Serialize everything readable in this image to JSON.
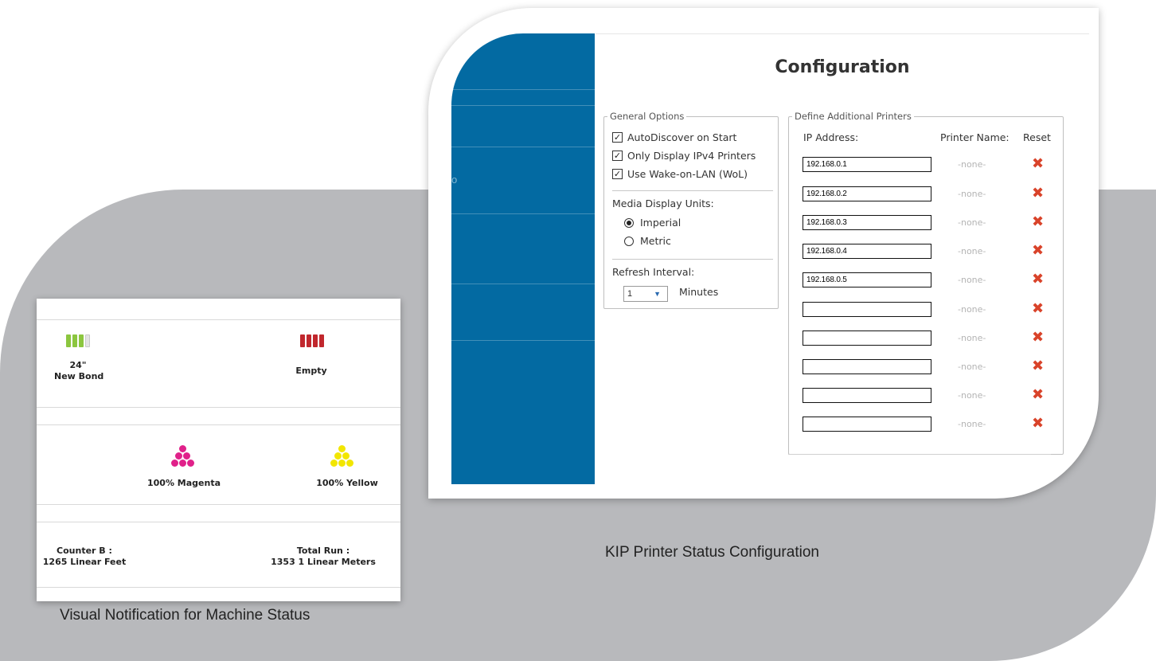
{
  "config": {
    "title": "Configuration",
    "sidebar_stub": "o",
    "general_options": {
      "legend": "General Options",
      "checkboxes": [
        {
          "label": "AutoDiscover on Start",
          "checked": true
        },
        {
          "label": "Only Display IPv4 Printers",
          "checked": true
        },
        {
          "label": "Use Wake-on-LAN (WoL)",
          "checked": true
        }
      ],
      "media_units_label": "Media Display Units:",
      "units": [
        {
          "label": "Imperial",
          "selected": true
        },
        {
          "label": "Metric",
          "selected": false
        }
      ],
      "refresh_label": "Refresh Interval:",
      "refresh_value": "1",
      "refresh_unit": "Minutes"
    },
    "printers": {
      "legend": "Define Additional Printers",
      "col_ip": "IP Address:",
      "col_name": "Printer Name:",
      "col_reset": "Reset",
      "rows": [
        {
          "ip": "192.168.0.1",
          "name": "-none-"
        },
        {
          "ip": "192.168.0.2",
          "name": "-none-"
        },
        {
          "ip": "192.168.0.3",
          "name": "-none-"
        },
        {
          "ip": "192.168.0.4",
          "name": "-none-"
        },
        {
          "ip": "192.168.0.5",
          "name": "-none-"
        },
        {
          "ip": "",
          "name": "-none-"
        },
        {
          "ip": "",
          "name": "-none-"
        },
        {
          "ip": "",
          "name": "-none-"
        },
        {
          "ip": "",
          "name": "-none-"
        },
        {
          "ip": "",
          "name": "-none-"
        }
      ],
      "reset_glyph": "✖"
    },
    "caption": "KIP Printer Status Configuration"
  },
  "status": {
    "rolls": [
      {
        "line1": "24\"",
        "line2": "New Bond",
        "level_bars": 3,
        "total_bars": 4,
        "color": "#8cc63f"
      },
      {
        "line1": "Empty",
        "line2": "",
        "level_bars": 4,
        "total_bars": 4,
        "color": "#c1272d"
      }
    ],
    "toners": [
      {
        "label": "100% Magenta",
        "color": "#e0218a"
      },
      {
        "label": "100% Yellow",
        "color": "#f2e600"
      }
    ],
    "counters": [
      {
        "label": "Counter B :",
        "value": "1265 Linear Feet"
      },
      {
        "label": "Total Run :",
        "value": "1353 1 Linear Meters"
      }
    ],
    "caption": "Visual Notification for Machine Status"
  }
}
